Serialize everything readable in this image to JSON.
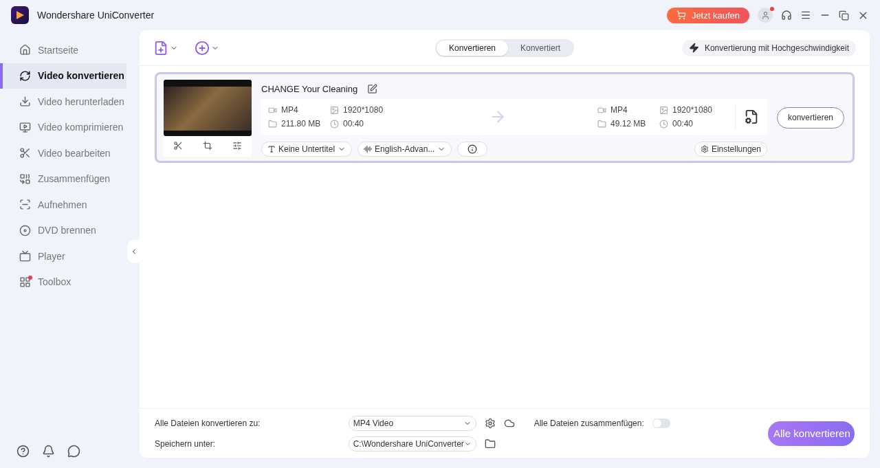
{
  "app": {
    "title": "Wondershare UniConverter"
  },
  "header": {
    "buy_button": "Jetzt kaufen"
  },
  "sidebar": {
    "items": [
      {
        "kind": "home",
        "label": "Startseite",
        "selected": false
      },
      {
        "kind": "convert",
        "label": "Video konvertieren",
        "selected": true
      },
      {
        "kind": "download",
        "label": "Video herunterladen",
        "selected": false
      },
      {
        "kind": "compress",
        "label": "Video komprimieren",
        "selected": false
      },
      {
        "kind": "edit",
        "label": "Video bearbeiten",
        "selected": false
      },
      {
        "kind": "merge",
        "label": "Zusammenfügen",
        "selected": false
      },
      {
        "kind": "record",
        "label": "Aufnehmen",
        "selected": false
      },
      {
        "kind": "dvd",
        "label": "DVD brennen",
        "selected": false
      },
      {
        "kind": "player",
        "label": "Player",
        "selected": false
      },
      {
        "kind": "toolbox",
        "label": "Toolbox",
        "selected": false
      }
    ]
  },
  "tabs": [
    {
      "label": "Konvertieren",
      "selected": true
    },
    {
      "label": "Konvertiert",
      "selected": false
    }
  ],
  "speed_button": "Konvertierung mit Hochgeschwindigkeit",
  "file": {
    "title": "CHANGE Your Cleaning",
    "source": {
      "format": "MP4",
      "resolution": "1920*1080",
      "size": "211.80 MB",
      "duration": "00:40"
    },
    "target": {
      "format": "MP4",
      "resolution": "1920*1080",
      "size": "49.12 MB",
      "duration": "00:40"
    },
    "subtitle": "Keine Untertitel",
    "audio": "English-Advan...",
    "settings": "Einstellungen",
    "convert": "konvertieren"
  },
  "footer": {
    "format_label": "Alle Dateien konvertieren zu:",
    "format_value": "MP4 Video",
    "merge_label": "Alle Dateien zusammenfügen:",
    "merge_on": false,
    "save_label": "Speichern unter:",
    "save_path": "C:\\Wondershare UniConverter",
    "convert_all": "Alle konvertieren"
  }
}
